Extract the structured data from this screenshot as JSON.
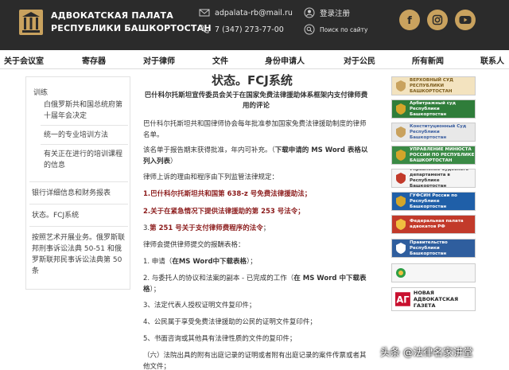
{
  "header": {
    "org_line1": "АДВОКАТСКАЯ ПАЛАТА",
    "org_line2": "РЕСПУБЛИКИ БАШКОРТОСТАН",
    "email": "adpalata-rb@mail.ru",
    "phone": "7 (347) 273-77-00",
    "login_label": "登录注册",
    "search_label": "Поиск по сайту"
  },
  "nav": {
    "items": [
      "关于会议室",
      "寄存器",
      "对于律师",
      "文件",
      "身份申请人",
      "对于公民",
      "所有新闻",
      "联系人"
    ]
  },
  "sidebar": {
    "title": "训练",
    "sub1": "白俄罗斯共和国总统府第十届年会决定",
    "sub2": "统一的专业培训方法",
    "sub3": "有关正在进行的培训课程的信息",
    "item1": "银行详细信息和财务报表",
    "item2": "状态。FCJ系统",
    "item3": "按照艺术开展业务。俄罗斯联邦刑事诉讼法典 50-51 和俄罗斯联邦民事诉讼法典第 50 条"
  },
  "main": {
    "title": "状态。FCJ系统",
    "subtitle": "巴什科尔托斯坦宣传委员会关于在国家免费法律援助体系框架内支付律师费用的评论",
    "p1": "巴什科尔托斯坦共和国律师协会每年批准参加国家免费法律援助制度的律师名单。",
    "p2a": "该名单于报告期末获得批准，年内可补充。（",
    "p2b": "下载申请的 MS Word 表格以列入列表",
    "p2c": "）",
    "p3": "律师上诉的理由和程序由下列监管法律规定：",
    "law1": "1.巴什科尔托斯坦共和国第 638-z 号免费法律援助法；",
    "law2": "2.关于在紧急情况下提供法律援助的第 253 号法令；",
    "law3a": "3.",
    "law3b": "第 251 号关于支付律师费程序的法令",
    "law3c": "；",
    "p4": "律师会提供律师提交的报酬表格：",
    "i1a": "1. 申请（",
    "i1b": "在MS Word中下载表格",
    "i1c": "）；",
    "i2a": "2. 与委托人的协议和法案的副本 - 已完成的工作（",
    "i2b": "在 MS Word 中下载表格",
    "i2c": "）；",
    "i3": "3、法定代表人授权证明文件复印件；",
    "i4": "4、公民属于享受免费法律援助的公民的证明文件复印件；",
    "i5": "5、书面咨询或其他具有法律性质的文件的复印件；",
    "i6": "（六）法院出具的附有出庭记录的证明或者附有出庭记录的案件传票或者其他文件；"
  },
  "banners": [
    {
      "text": "ВЕРХОВНЫЙ СУД РЕСПУБЛИКИ БАШКОРТОСТАН",
      "bg": "#f3e3bf",
      "color": "#7a5a1a"
    },
    {
      "text": "Арбитражный суд Республики Башкортостан",
      "bg": "#2f7d3a",
      "color": "#ffffff"
    },
    {
      "text": "Конституционный Суд Республики Башкортостан",
      "bg": "#e8e8e8",
      "color": "#3a5ea0"
    },
    {
      "text": "УПРАВЛЕНИЕ МИНЮСТА РОССИИ ПО РЕСПУБЛИКЕ БАШКОРТОСТАН",
      "bg": "#3a8a45",
      "color": "#ffffff"
    },
    {
      "text": "Управление Судебного департамента в Республике Башкортостан",
      "bg": "#f4f4f4",
      "color": "#333333"
    },
    {
      "text": "ГУФСИН России по Республике Башкортостан",
      "bg": "#1f5fa8",
      "color": "#ffffff"
    },
    {
      "text": "Федеральная палата адвокатов РФ",
      "bg": "#c23a2a",
      "color": "#ffffff"
    },
    {
      "text": "Правительство Республики Башкортостан",
      "bg": "#2f5e9e",
      "color": "#ffffff"
    },
    {
      "text": "",
      "bg": "#f6f6f6",
      "color": "#333333"
    },
    {
      "text": "НОВАЯ АДВОКАТСКАЯ ГАЗЕТА",
      "bg": "#ffffff",
      "color": "#222222"
    }
  ],
  "watermark": "头条 @法律名家讲堂",
  "colors": {
    "header_bg": "#2b2b2b",
    "accent_gold": "#c9a25e",
    "link_red": "#8b1a1a"
  }
}
